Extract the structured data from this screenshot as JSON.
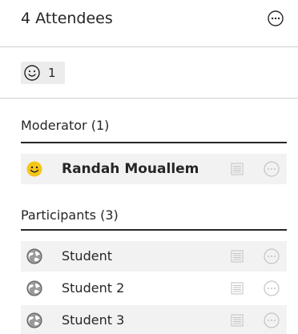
{
  "header": {
    "title": "4 Attendees",
    "more_icon": "ellipsis-circle-icon"
  },
  "emoji_filter": {
    "icon": "smiley-icon",
    "count": "1"
  },
  "moderators": {
    "heading": "Moderator (1)",
    "items": [
      {
        "name": "Randah Mouallem",
        "avatar": "yellow-smiley-avatar",
        "list_icon": "lines-icon",
        "options_icon": "ellipsis-circle-icon"
      }
    ]
  },
  "participants": {
    "heading": "Participants (3)",
    "items": [
      {
        "name": "Student",
        "avatar": "globe-avatar",
        "list_icon": "lines-icon",
        "options_icon": "ellipsis-circle-icon"
      },
      {
        "name": "Student 2",
        "avatar": "globe-avatar",
        "list_icon": "lines-icon",
        "options_icon": "ellipsis-circle-icon"
      },
      {
        "name": "Student 3",
        "avatar": "globe-avatar",
        "list_icon": "lines-icon",
        "options_icon": "ellipsis-circle-icon"
      }
    ]
  },
  "colors": {
    "text": "#262626",
    "divider": "#cfcfcf",
    "row_bg": "#f2f2f2",
    "avatar_yellow": "#f5c518",
    "icon_muted": "#c2c2c2"
  }
}
